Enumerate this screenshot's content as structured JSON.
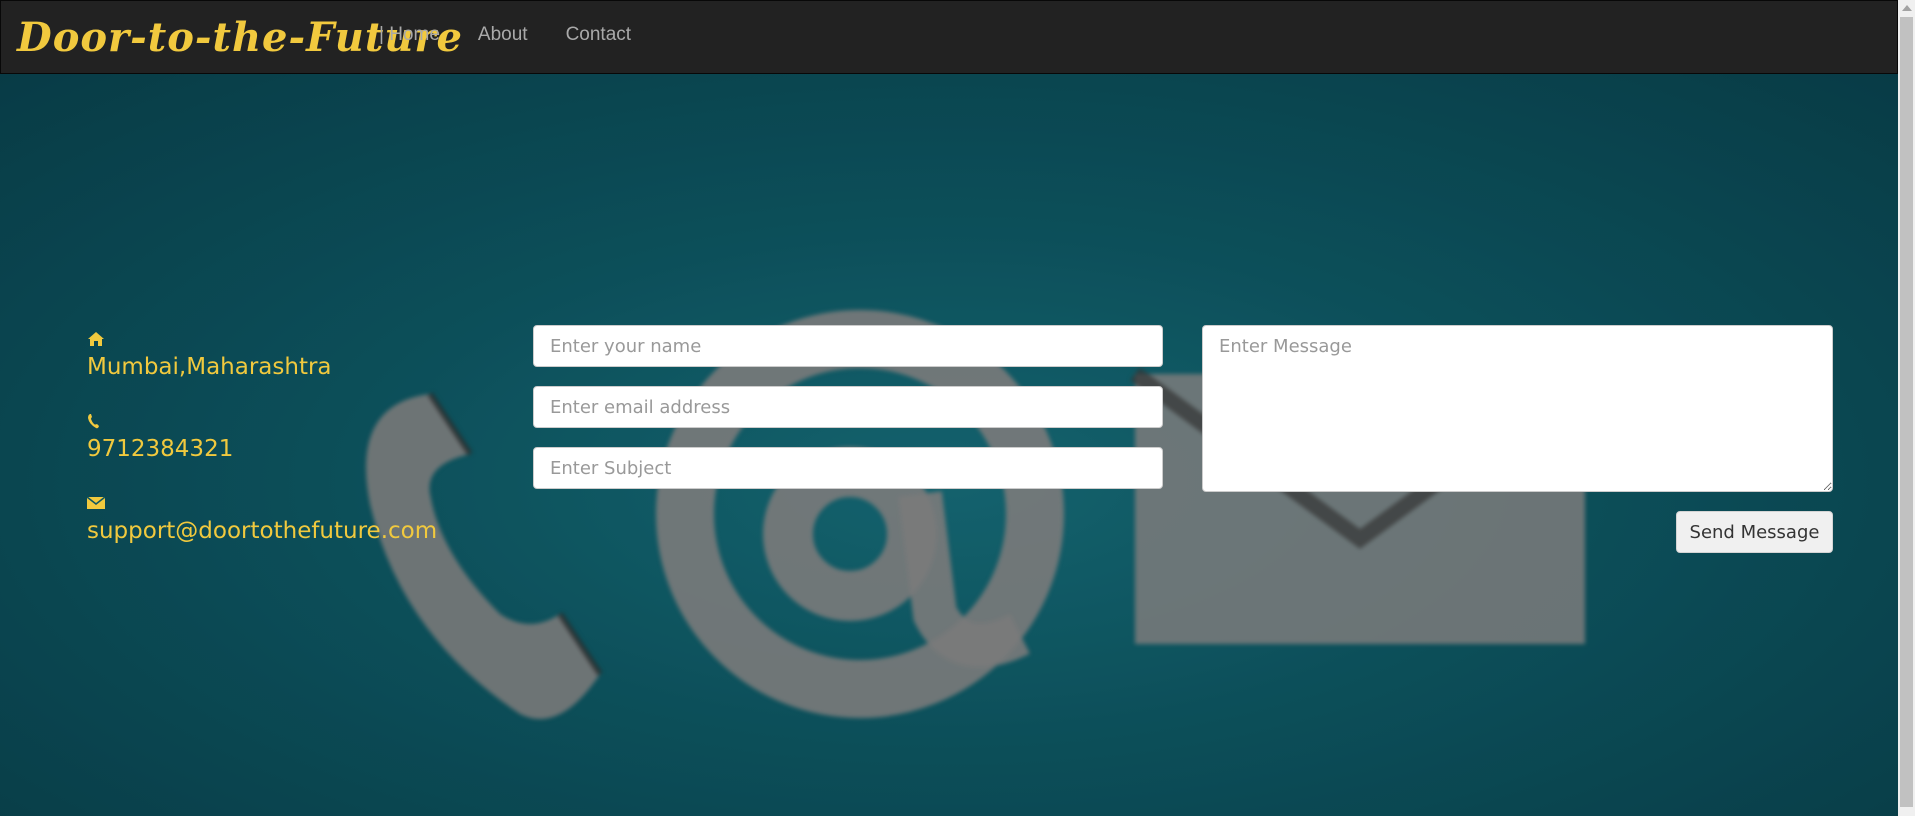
{
  "navbar": {
    "brand": "Door-to-the-Future",
    "links": [
      {
        "label": "| Home"
      },
      {
        "label": "About"
      },
      {
        "label": "Contact"
      }
    ]
  },
  "contact_info": {
    "address": "Mumbai,Maharashtra",
    "phone": "9712384321",
    "email": "support@doortothefuture.com"
  },
  "form": {
    "name_placeholder": "Enter your name",
    "email_placeholder": "Enter email address",
    "subject_placeholder": "Enter Subject",
    "message_placeholder": "Enter Message",
    "send_label": "Send Message"
  },
  "colors": {
    "accent": "#f1c93e",
    "navbar": "#222222",
    "background": "#0f5661"
  }
}
